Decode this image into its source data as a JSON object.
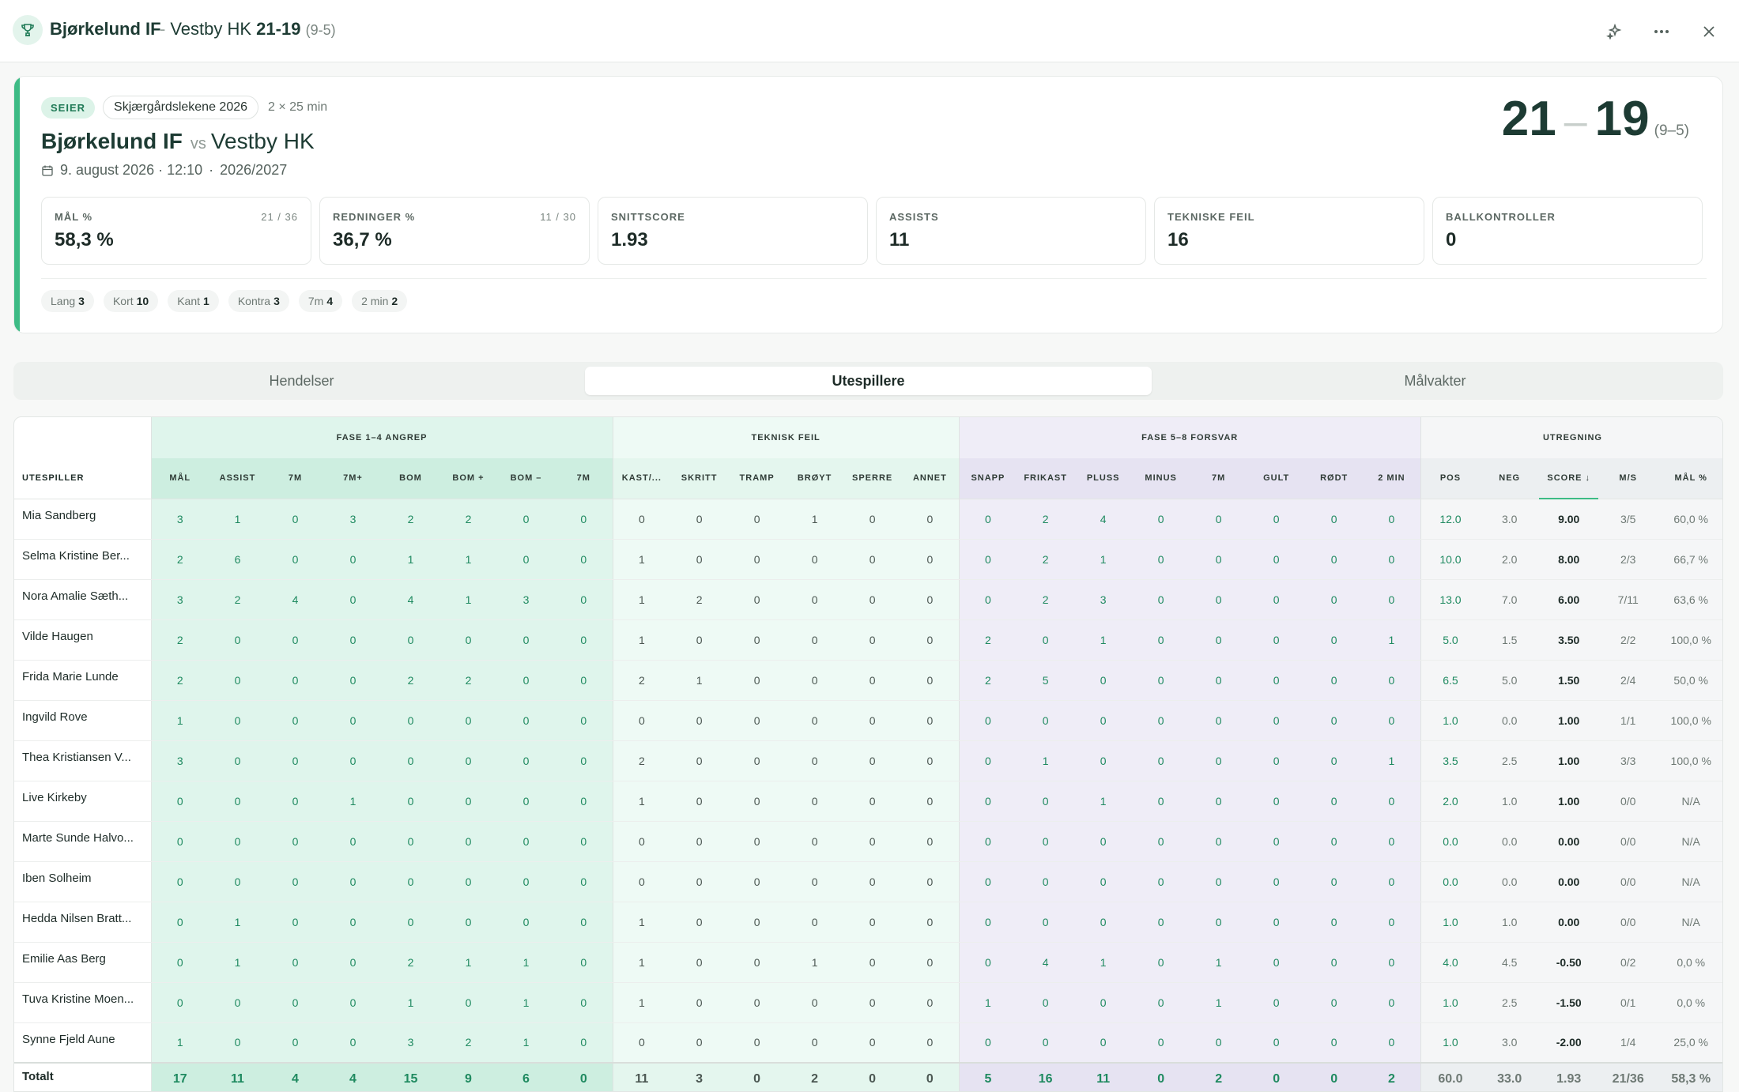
{
  "topbar": {
    "title": "Bjørkelund IF",
    "opponent": "Vestby HK",
    "score": "21-19",
    "halftime": "(9-5)"
  },
  "card": {
    "result_badge": "SEIER",
    "tournament": "Skjærgårdslekene 2026",
    "duration": "2 × 25 min",
    "home": "Bjørkelund IF",
    "vs": "vs",
    "away": "Vestby HK",
    "date": "9. august 2026 · 12:10",
    "season": "2026/2027",
    "home_goals": "21",
    "away_goals": "19",
    "halftime": "(9–5)",
    "accent": "#3dbb85"
  },
  "stats": [
    {
      "label": "MÅL %",
      "value": "58,3 %",
      "frac": "21 / 36"
    },
    {
      "label": "REDNINGER %",
      "value": "36,7 %",
      "frac": "11 / 30"
    },
    {
      "label": "SNITTSCORE",
      "value": "1.93",
      "frac": ""
    },
    {
      "label": "ASSISTS",
      "value": "11",
      "frac": ""
    },
    {
      "label": "TEKNISKE FEIL",
      "value": "16",
      "frac": ""
    },
    {
      "label": "BALLKONTROLLER",
      "value": "0",
      "frac": ""
    }
  ],
  "chips": [
    {
      "label": "Lang",
      "value": "3"
    },
    {
      "label": "Kort",
      "value": "10"
    },
    {
      "label": "Kant",
      "value": "1"
    },
    {
      "label": "Kontra",
      "value": "3"
    },
    {
      "label": "7m",
      "value": "4"
    },
    {
      "label": "2 min",
      "value": "2"
    }
  ],
  "tabs": [
    {
      "label": "Hendelser",
      "active": false
    },
    {
      "label": "Utespillere",
      "active": true
    },
    {
      "label": "Målvakter",
      "active": false
    }
  ],
  "table": {
    "groups": [
      {
        "label": "",
        "span": 1,
        "cls": ""
      },
      {
        "label": "FASE 1–4 ANGREP",
        "span": 8,
        "cls": "g1"
      },
      {
        "label": "TEKNISK FEIL",
        "span": 6,
        "cls": "g2"
      },
      {
        "label": "FASE 5–8 FORSVAR",
        "span": 8,
        "cls": "g3"
      },
      {
        "label": "UTREGNING",
        "span": 5,
        "cls": "g4"
      }
    ],
    "columns": [
      "UTESPILLER",
      "MÅL",
      "ASSIST",
      "7M",
      "7M+",
      "BOM",
      "BOM +",
      "BOM –",
      "7M",
      "KAST/...",
      "SKRITT",
      "TRAMP",
      "BRØYT",
      "SPERRE",
      "ANNET",
      "SNAPP",
      "FRIKAST",
      "PLUSS",
      "MINUS",
      "7M",
      "GULT",
      "RØDT",
      "2 MIN",
      "POS",
      "NEG",
      "SCORE ↓",
      "M/S",
      "MÅL %"
    ],
    "rows": [
      [
        "Mia Sandberg",
        "3",
        "1",
        "0",
        "3",
        "2",
        "2",
        "0",
        "0",
        "0",
        "0",
        "0",
        "1",
        "0",
        "0",
        "0",
        "2",
        "4",
        "0",
        "0",
        "0",
        "0",
        "0",
        "12.0",
        "3.0",
        "9.00",
        "3/5",
        "60,0 %"
      ],
      [
        "Selma Kristine Ber...",
        "2",
        "6",
        "0",
        "0",
        "1",
        "1",
        "0",
        "0",
        "1",
        "0",
        "0",
        "0",
        "0",
        "0",
        "0",
        "2",
        "1",
        "0",
        "0",
        "0",
        "0",
        "0",
        "10.0",
        "2.0",
        "8.00",
        "2/3",
        "66,7 %"
      ],
      [
        "Nora Amalie Sæth...",
        "3",
        "2",
        "4",
        "0",
        "4",
        "1",
        "3",
        "0",
        "1",
        "2",
        "0",
        "0",
        "0",
        "0",
        "0",
        "2",
        "3",
        "0",
        "0",
        "0",
        "0",
        "0",
        "13.0",
        "7.0",
        "6.00",
        "7/11",
        "63,6 %"
      ],
      [
        "Vilde Haugen",
        "2",
        "0",
        "0",
        "0",
        "0",
        "0",
        "0",
        "0",
        "1",
        "0",
        "0",
        "0",
        "0",
        "0",
        "2",
        "0",
        "1",
        "0",
        "0",
        "0",
        "0",
        "1",
        "5.0",
        "1.5",
        "3.50",
        "2/2",
        "100,0 %"
      ],
      [
        "Frida Marie Lunde",
        "2",
        "0",
        "0",
        "0",
        "2",
        "2",
        "0",
        "0",
        "2",
        "1",
        "0",
        "0",
        "0",
        "0",
        "2",
        "5",
        "0",
        "0",
        "0",
        "0",
        "0",
        "0",
        "6.5",
        "5.0",
        "1.50",
        "2/4",
        "50,0 %"
      ],
      [
        "Ingvild Rove",
        "1",
        "0",
        "0",
        "0",
        "0",
        "0",
        "0",
        "0",
        "0",
        "0",
        "0",
        "0",
        "0",
        "0",
        "0",
        "0",
        "0",
        "0",
        "0",
        "0",
        "0",
        "0",
        "1.0",
        "0.0",
        "1.00",
        "1/1",
        "100,0 %"
      ],
      [
        "Thea Kristiansen V...",
        "3",
        "0",
        "0",
        "0",
        "0",
        "0",
        "0",
        "0",
        "2",
        "0",
        "0",
        "0",
        "0",
        "0",
        "0",
        "1",
        "0",
        "0",
        "0",
        "0",
        "0",
        "1",
        "3.5",
        "2.5",
        "1.00",
        "3/3",
        "100,0 %"
      ],
      [
        "Live Kirkeby",
        "0",
        "0",
        "0",
        "1",
        "0",
        "0",
        "0",
        "0",
        "1",
        "0",
        "0",
        "0",
        "0",
        "0",
        "0",
        "0",
        "1",
        "0",
        "0",
        "0",
        "0",
        "0",
        "2.0",
        "1.0",
        "1.00",
        "0/0",
        "N/A"
      ],
      [
        "Marte Sunde Halvo...",
        "0",
        "0",
        "0",
        "0",
        "0",
        "0",
        "0",
        "0",
        "0",
        "0",
        "0",
        "0",
        "0",
        "0",
        "0",
        "0",
        "0",
        "0",
        "0",
        "0",
        "0",
        "0",
        "0.0",
        "0.0",
        "0.00",
        "0/0",
        "N/A"
      ],
      [
        "Iben Solheim",
        "0",
        "0",
        "0",
        "0",
        "0",
        "0",
        "0",
        "0",
        "0",
        "0",
        "0",
        "0",
        "0",
        "0",
        "0",
        "0",
        "0",
        "0",
        "0",
        "0",
        "0",
        "0",
        "0.0",
        "0.0",
        "0.00",
        "0/0",
        "N/A"
      ],
      [
        "Hedda Nilsen Bratt...",
        "0",
        "1",
        "0",
        "0",
        "0",
        "0",
        "0",
        "0",
        "1",
        "0",
        "0",
        "0",
        "0",
        "0",
        "0",
        "0",
        "0",
        "0",
        "0",
        "0",
        "0",
        "0",
        "1.0",
        "1.0",
        "0.00",
        "0/0",
        "N/A"
      ],
      [
        "Emilie Aas Berg",
        "0",
        "1",
        "0",
        "0",
        "2",
        "1",
        "1",
        "0",
        "1",
        "0",
        "0",
        "1",
        "0",
        "0",
        "0",
        "4",
        "1",
        "0",
        "1",
        "0",
        "0",
        "0",
        "4.0",
        "4.5",
        "-0.50",
        "0/2",
        "0,0 %"
      ],
      [
        "Tuva Kristine Moen...",
        "0",
        "0",
        "0",
        "0",
        "1",
        "0",
        "1",
        "0",
        "1",
        "0",
        "0",
        "0",
        "0",
        "0",
        "1",
        "0",
        "0",
        "0",
        "1",
        "0",
        "0",
        "0",
        "1.0",
        "2.5",
        "-1.50",
        "0/1",
        "0,0 %"
      ],
      [
        "Synne Fjeld Aune",
        "1",
        "0",
        "0",
        "0",
        "3",
        "2",
        "1",
        "0",
        "0",
        "0",
        "0",
        "0",
        "0",
        "0",
        "0",
        "0",
        "0",
        "0",
        "0",
        "0",
        "0",
        "0",
        "1.0",
        "3.0",
        "-2.00",
        "1/4",
        "25,0 %"
      ]
    ],
    "total": [
      "Totalt",
      "17",
      "11",
      "4",
      "4",
      "15",
      "9",
      "6",
      "0",
      "11",
      "3",
      "0",
      "2",
      "0",
      "0",
      "5",
      "16",
      "11",
      "0",
      "2",
      "0",
      "0",
      "2",
      "60.0",
      "33.0",
      "1.93",
      "21/36",
      "58,3 %"
    ]
  }
}
